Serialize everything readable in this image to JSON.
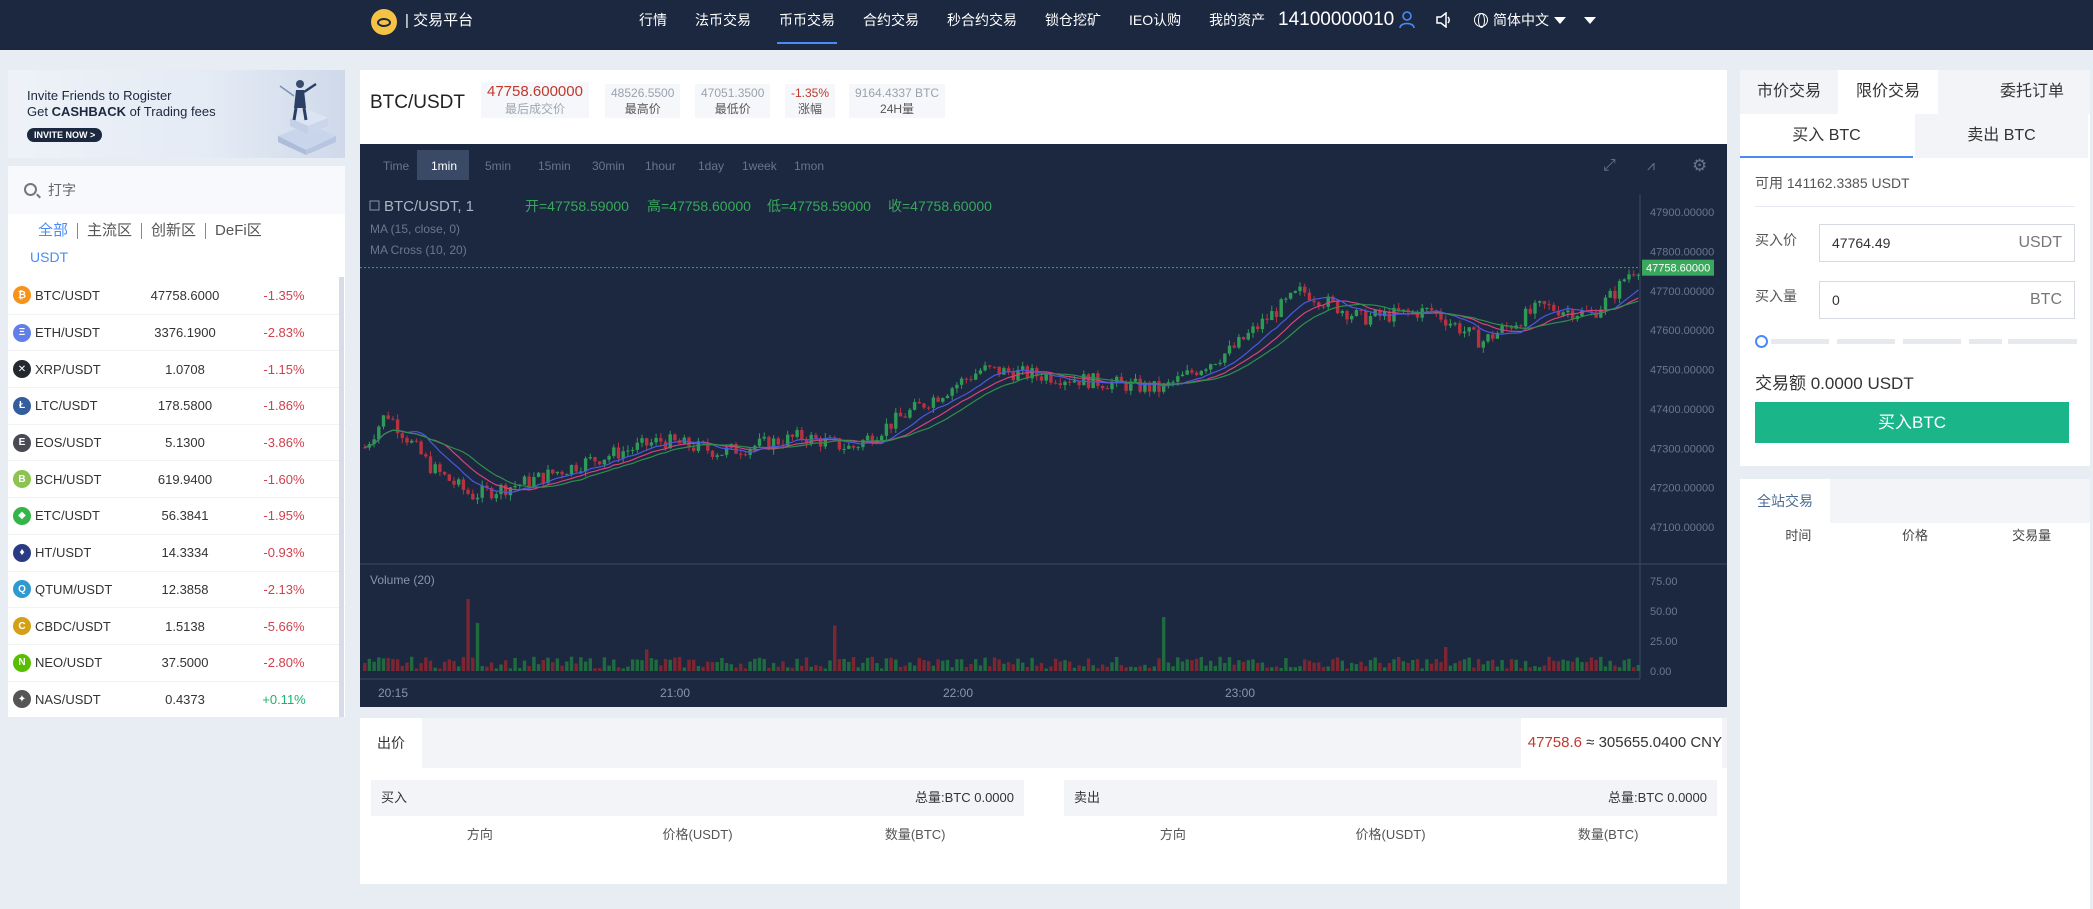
{
  "header": {
    "brand": "| 交易平台",
    "nav": [
      "行情",
      "法币交易",
      "币币交易",
      "合约交易",
      "秒合约交易",
      "锁仓挖矿",
      "IEO认购",
      "我的资产"
    ],
    "active_nav": "币币交易",
    "phone": "14100000010",
    "language": "简体中文",
    "icons": [
      "user-icon",
      "speaker-icon",
      "globe-icon",
      "chevron-down-icon"
    ]
  },
  "promo": {
    "line1": "Invite Friends to Rogister",
    "line2_pre": "Get ",
    "line2_bold": "CASHBACK",
    "line2_post": " of Trading fees",
    "button": "INVITE NOW >"
  },
  "market": {
    "search_placeholder": "打字",
    "tabs": [
      "全部",
      "主流区",
      "创新区",
      "DeFi区"
    ],
    "active_tab": "全部",
    "quote": "USDT",
    "pairs": [
      {
        "name": "BTC/USDT",
        "price": "47758.6000",
        "change": "-1.35%",
        "dir": "down",
        "icon": "btc-icon",
        "color": "#f7931a",
        "glyph": "₿"
      },
      {
        "name": "ETH/USDT",
        "price": "3376.1900",
        "change": "-2.83%",
        "dir": "down",
        "icon": "eth-icon",
        "color": "#627eea",
        "glyph": "Ξ"
      },
      {
        "name": "XRP/USDT",
        "price": "1.0708",
        "change": "-1.15%",
        "dir": "down",
        "icon": "xrp-icon",
        "color": "#23292f",
        "glyph": "✕"
      },
      {
        "name": "LTC/USDT",
        "price": "178.5800",
        "change": "-1.86%",
        "dir": "down",
        "icon": "ltc-icon",
        "color": "#345d9d",
        "glyph": "Ł"
      },
      {
        "name": "EOS/USDT",
        "price": "5.1300",
        "change": "-3.86%",
        "dir": "down",
        "icon": "eos-icon",
        "color": "#4a4a55",
        "glyph": "E"
      },
      {
        "name": "BCH/USDT",
        "price": "619.9400",
        "change": "-1.60%",
        "dir": "down",
        "icon": "bch-icon",
        "color": "#8dc351",
        "glyph": "B"
      },
      {
        "name": "ETC/USDT",
        "price": "56.3841",
        "change": "-1.95%",
        "dir": "down",
        "icon": "etc-icon",
        "color": "#33b54a",
        "glyph": "◆"
      },
      {
        "name": "HT/USDT",
        "price": "14.3334",
        "change": "-0.93%",
        "dir": "down",
        "icon": "ht-icon",
        "color": "#2a3b84",
        "glyph": "♦"
      },
      {
        "name": "QTUM/USDT",
        "price": "12.3858",
        "change": "-2.13%",
        "dir": "down",
        "icon": "qtum-icon",
        "color": "#2e9ad0",
        "glyph": "Q"
      },
      {
        "name": "CBDC/USDT",
        "price": "1.5138",
        "change": "-5.66%",
        "dir": "down",
        "icon": "cbdc-icon",
        "color": "#d4a017",
        "glyph": "C"
      },
      {
        "name": "NEO/USDT",
        "price": "37.5000",
        "change": "-2.80%",
        "dir": "down",
        "icon": "neo-icon",
        "color": "#58bf00",
        "glyph": "N"
      },
      {
        "name": "NAS/USDT",
        "price": "0.4373",
        "change": "+0.11%",
        "dir": "up",
        "icon": "nas-icon",
        "color": "#555555",
        "glyph": "✦"
      }
    ]
  },
  "ticker": {
    "pair": "BTC/USDT",
    "last_price": "47758.600000",
    "last_label": "最后成交价",
    "high": "48526.5500",
    "high_label": "最高价",
    "low": "47051.3500",
    "low_label": "最低价",
    "change": "-1.35%",
    "change_label": "涨幅",
    "volume": "9164.4337 BTC",
    "volume_label": "24H量"
  },
  "chart": {
    "intervals": [
      "Time",
      "1min",
      "5min",
      "15min",
      "30min",
      "1hour",
      "1day",
      "1week",
      "1mon"
    ],
    "active_interval": "1min",
    "legend_main": "BTC/USDT, 1",
    "open": "开=47758.59000",
    "high": "高=47758.60000",
    "low": "低=47758.59000",
    "close": "收=47758.60000",
    "ma1": "MA (15, close, 0)",
    "ma2": "MA Cross (10, 20)",
    "vol_label": "Volume (20)",
    "price_ticks": [
      "47900.00000",
      "47800.00000",
      "47700.00000",
      "47600.00000",
      "47500.00000",
      "47400.00000",
      "47300.00000",
      "47200.00000",
      "47100.00000"
    ],
    "current_price_tag": "47758.60000",
    "vol_ticks": [
      "75.00",
      "50.00",
      "25.00",
      "0.00"
    ],
    "time_ticks": [
      "20:15",
      "21:00",
      "22:00",
      "23:00"
    ],
    "colors": {
      "up": "#2f9a56",
      "down": "#b8313f",
      "bg": "#1b2840"
    }
  },
  "book": {
    "tab": "出价",
    "last": "47758.6",
    "cny": " ≈ 305655.0400 CNY",
    "buy_label": "买入",
    "buy_total": "总量:BTC 0.0000",
    "sell_label": "卖出",
    "sell_total": "总量:BTC 0.0000",
    "cols": [
      "方向",
      "价格(USDT)",
      "数量(BTC)"
    ]
  },
  "trade": {
    "tabs": [
      "市价交易",
      "限价交易",
      "委托订单"
    ],
    "active_tab": "限价交易",
    "buy_tab": "买入 BTC",
    "sell_tab": "卖出 BTC",
    "available": "可用 141162.3385 USDT",
    "price_label": "买入价",
    "price_value": "47764.49",
    "price_unit": "USDT",
    "qty_label": "买入量",
    "qty_value": "0",
    "qty_unit": "BTC",
    "amount": "交易额 0.0000 USDT",
    "button": "买入BTC"
  },
  "global_trades": {
    "tab": "全站交易",
    "cols": [
      "时间",
      "价格",
      "交易量"
    ]
  }
}
